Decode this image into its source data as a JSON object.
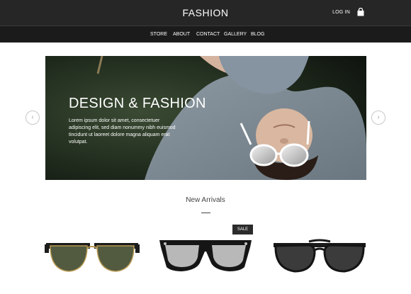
{
  "header": {
    "brand": "FASHION",
    "login_label": "LOG IN",
    "cart_icon": "shopping-bag-icon"
  },
  "nav": {
    "items": [
      {
        "label": "STORE"
      },
      {
        "label": "ABOUT"
      },
      {
        "label": "CONTACT"
      },
      {
        "label": "GALLERY"
      },
      {
        "label": "BLOG"
      }
    ]
  },
  "hero": {
    "title": "DESIGN & FASHION",
    "text": "Lorem ipsum dolor sit amet, consectetuer adipiscing elit, sed diam nonummy nibh euismod tincidunt ut laoreet dolore magna aliquam erat volutpat.",
    "prev_icon": "chevron-left-icon",
    "next_icon": "chevron-right-icon"
  },
  "arrivals": {
    "title": "New Arrivals",
    "badge": "SALE",
    "products": [
      {
        "icon": "sunglasses-clubmaster-icon"
      },
      {
        "icon": "sunglasses-wayfarer-icon"
      },
      {
        "icon": "sunglasses-aviator-icon"
      }
    ]
  },
  "colors": {
    "topbar": "#262626",
    "navbar": "#1b1b1b",
    "accent_text": "#ffffff"
  }
}
